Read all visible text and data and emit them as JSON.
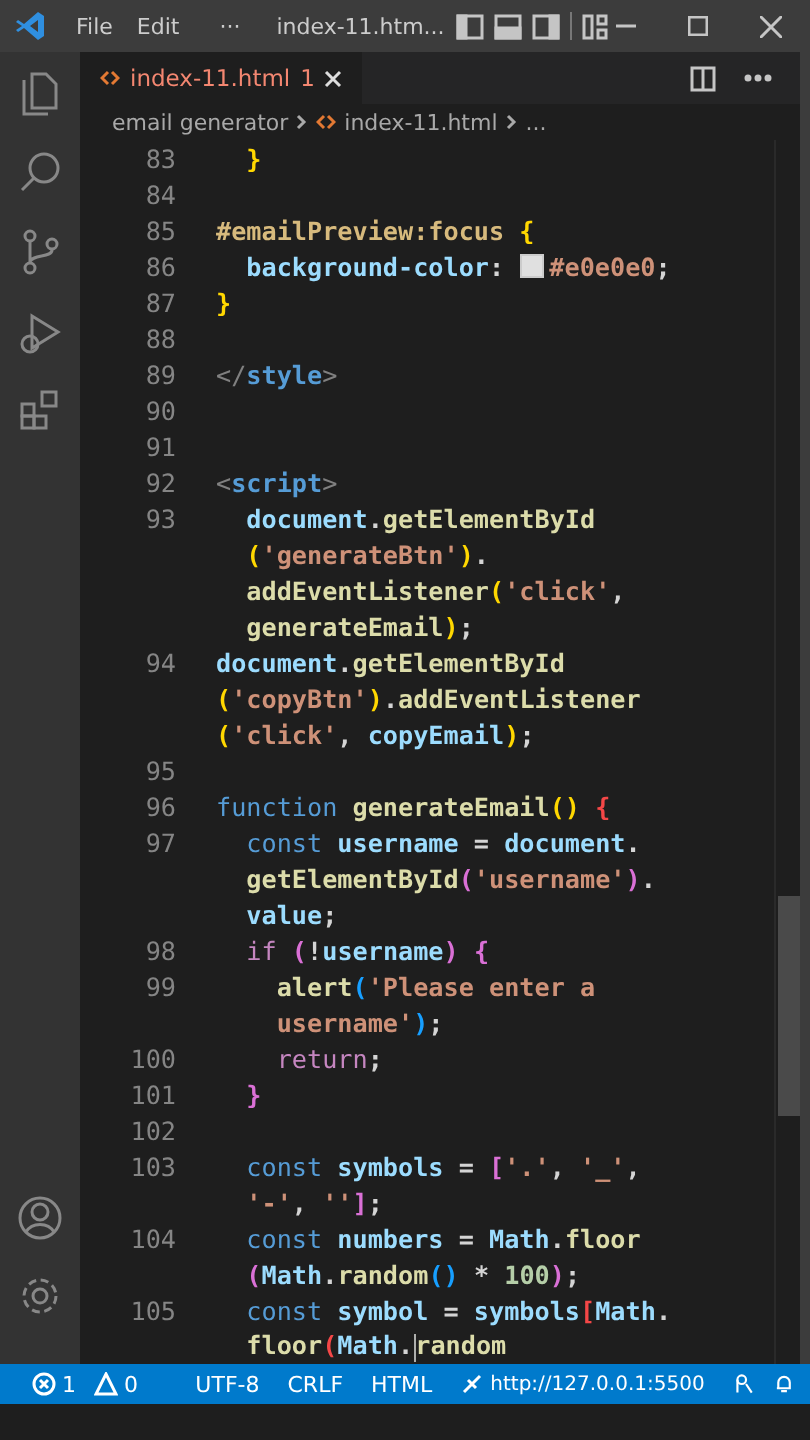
{
  "title_bar": {
    "menu": [
      "File",
      "Edit"
    ],
    "more": "···",
    "title": "index-11.htm..."
  },
  "tabs": [
    {
      "label": "index-11.html",
      "badge": "1",
      "has_error": true,
      "selected": true
    }
  ],
  "breadcrumbs": [
    "email generator",
    "index-11.html",
    "..."
  ],
  "editor": {
    "lines": [
      {
        "number": "83",
        "rows": [
          {
            "tokens": [
              {
                "kind": "br1",
                "text": "  }"
              }
            ]
          }
        ]
      },
      {
        "number": "84",
        "rows": [
          {
            "tokens": []
          }
        ]
      },
      {
        "number": "85",
        "rows": [
          {
            "tokens": [
              {
                "kind": "sel",
                "text": "#emailPreview:focus "
              },
              {
                "kind": "br1",
                "text": "{"
              }
            ]
          }
        ]
      },
      {
        "number": "86",
        "rows": [
          {
            "tokens": [
              {
                "kind": "prop",
                "text": "  background-color"
              },
              {
                "kind": "p",
                "text": ": "
              },
              {
                "kind": "swatch",
                "color": "#e0e0e0"
              },
              {
                "kind": "str",
                "text": "#e0e0e0"
              },
              {
                "kind": "p",
                "text": ";"
              }
            ]
          }
        ]
      },
      {
        "number": "87",
        "rows": [
          {
            "tokens": [
              {
                "kind": "br1",
                "text": "}"
              }
            ]
          }
        ]
      },
      {
        "number": "88",
        "rows": [
          {
            "tokens": []
          }
        ]
      },
      {
        "number": "89",
        "rows": [
          {
            "tokens": [
              {
                "kind": "tag",
                "text": "</"
              },
              {
                "kind": "tagname",
                "text": "style"
              },
              {
                "kind": "tag",
                "text": ">"
              }
            ]
          }
        ]
      },
      {
        "number": "90",
        "rows": [
          {
            "tokens": []
          }
        ]
      },
      {
        "number": "91",
        "rows": [
          {
            "tokens": []
          }
        ]
      },
      {
        "number": "92",
        "rows": [
          {
            "tokens": [
              {
                "kind": "tag",
                "text": "<"
              },
              {
                "kind": "tagname",
                "text": "script"
              },
              {
                "kind": "tag",
                "text": ">"
              }
            ]
          }
        ]
      },
      {
        "number": "93",
        "rows": [
          {
            "tokens": [
              {
                "kind": "var",
                "text": "  document"
              },
              {
                "kind": "p",
                "text": "."
              },
              {
                "kind": "fn",
                "text": "getElementById"
              }
            ]
          },
          {
            "tokens": [
              {
                "kind": "br1",
                "text": "  ("
              },
              {
                "kind": "str",
                "text": "'generateBtn'"
              },
              {
                "kind": "br1",
                "text": ")"
              },
              {
                "kind": "p",
                "text": "."
              }
            ]
          },
          {
            "tokens": [
              {
                "kind": "fn",
                "text": "  addEventListener"
              },
              {
                "kind": "br1",
                "text": "("
              },
              {
                "kind": "str",
                "text": "'click'"
              },
              {
                "kind": "p",
                "text": ","
              }
            ]
          },
          {
            "tokens": [
              {
                "kind": "fn",
                "text": "  generateEmail"
              },
              {
                "kind": "br1",
                "text": ")"
              },
              {
                "kind": "p",
                "text": ";"
              }
            ]
          }
        ]
      },
      {
        "number": "94",
        "rows": [
          {
            "tokens": [
              {
                "kind": "var",
                "text": "document"
              },
              {
                "kind": "p",
                "text": "."
              },
              {
                "kind": "fn",
                "text": "getElementById"
              }
            ]
          },
          {
            "tokens": [
              {
                "kind": "br1",
                "text": "("
              },
              {
                "kind": "str",
                "text": "'copyBtn'"
              },
              {
                "kind": "br1",
                "text": ")"
              },
              {
                "kind": "p",
                "text": "."
              },
              {
                "kind": "fn",
                "text": "addEventListener"
              }
            ]
          },
          {
            "tokens": [
              {
                "kind": "br1",
                "text": "("
              },
              {
                "kind": "str",
                "text": "'click'"
              },
              {
                "kind": "p",
                "text": ", "
              },
              {
                "kind": "var",
                "text": "copyEmail"
              },
              {
                "kind": "br1",
                "text": ")"
              },
              {
                "kind": "p",
                "text": ";"
              }
            ]
          }
        ]
      },
      {
        "number": "95",
        "rows": [
          {
            "tokens": []
          }
        ]
      },
      {
        "number": "96",
        "rows": [
          {
            "tokens": [
              {
                "kind": "kw",
                "text": "function "
              },
              {
                "kind": "fn",
                "text": "generateEmail"
              },
              {
                "kind": "br1",
                "text": "() "
              },
              {
                "kind": "err",
                "text": "{"
              }
            ]
          }
        ]
      },
      {
        "number": "97",
        "rows": [
          {
            "tokens": [
              {
                "kind": "kw",
                "text": "  const "
              },
              {
                "kind": "var",
                "text": "username"
              },
              {
                "kind": "p",
                "text": " = "
              },
              {
                "kind": "var",
                "text": "document"
              },
              {
                "kind": "p",
                "text": "."
              }
            ]
          },
          {
            "tokens": [
              {
                "kind": "fn",
                "text": "  getElementById"
              },
              {
                "kind": "br2",
                "text": "("
              },
              {
                "kind": "str",
                "text": "'username'"
              },
              {
                "kind": "br2",
                "text": ")"
              },
              {
                "kind": "p",
                "text": "."
              }
            ]
          },
          {
            "tokens": [
              {
                "kind": "var",
                "text": "  value"
              },
              {
                "kind": "p",
                "text": ";"
              }
            ]
          }
        ]
      },
      {
        "number": "98",
        "rows": [
          {
            "tokens": [
              {
                "kind": "ctrl",
                "text": "  if "
              },
              {
                "kind": "br2",
                "text": "("
              },
              {
                "kind": "p",
                "text": "!"
              },
              {
                "kind": "var",
                "text": "username"
              },
              {
                "kind": "br2",
                "text": ") {"
              }
            ]
          }
        ]
      },
      {
        "number": "99",
        "rows": [
          {
            "tokens": [
              {
                "kind": "fn",
                "text": "    alert"
              },
              {
                "kind": "br3",
                "text": "("
              },
              {
                "kind": "str",
                "text": "'Please enter a"
              }
            ]
          },
          {
            "tokens": [
              {
                "kind": "str",
                "text": "    username'"
              },
              {
                "kind": "br3",
                "text": ")"
              },
              {
                "kind": "p",
                "text": ";"
              }
            ]
          }
        ]
      },
      {
        "number": "100",
        "rows": [
          {
            "tokens": [
              {
                "kind": "ctrl",
                "text": "    return"
              },
              {
                "kind": "p",
                "text": ";"
              }
            ]
          }
        ]
      },
      {
        "number": "101",
        "rows": [
          {
            "tokens": [
              {
                "kind": "br2",
                "text": "  }"
              }
            ]
          }
        ]
      },
      {
        "number": "102",
        "rows": [
          {
            "tokens": []
          }
        ]
      },
      {
        "number": "103",
        "rows": [
          {
            "tokens": [
              {
                "kind": "kw",
                "text": "  const "
              },
              {
                "kind": "var",
                "text": "symbols"
              },
              {
                "kind": "p",
                "text": " = "
              },
              {
                "kind": "br2",
                "text": "["
              },
              {
                "kind": "str",
                "text": "'.'"
              },
              {
                "kind": "p",
                "text": ", "
              },
              {
                "kind": "str",
                "text": "'_'"
              },
              {
                "kind": "p",
                "text": ","
              }
            ]
          },
          {
            "tokens": [
              {
                "kind": "str",
                "text": "  '-'"
              },
              {
                "kind": "p",
                "text": ", "
              },
              {
                "kind": "str",
                "text": "''"
              },
              {
                "kind": "br2",
                "text": "]"
              },
              {
                "kind": "p",
                "text": ";"
              }
            ]
          }
        ]
      },
      {
        "number": "104",
        "rows": [
          {
            "tokens": [
              {
                "kind": "kw",
                "text": "  const "
              },
              {
                "kind": "var",
                "text": "numbers"
              },
              {
                "kind": "p",
                "text": " = "
              },
              {
                "kind": "var",
                "text": "Math"
              },
              {
                "kind": "p",
                "text": "."
              },
              {
                "kind": "fn",
                "text": "floor"
              }
            ]
          },
          {
            "tokens": [
              {
                "kind": "br2",
                "text": "  ("
              },
              {
                "kind": "var",
                "text": "Math"
              },
              {
                "kind": "p",
                "text": "."
              },
              {
                "kind": "fn",
                "text": "random"
              },
              {
                "kind": "br3",
                "text": "()"
              },
              {
                "kind": "p",
                "text": " * "
              },
              {
                "kind": "num",
                "text": "100"
              },
              {
                "kind": "br2",
                "text": ")"
              },
              {
                "kind": "p",
                "text": ";"
              }
            ]
          }
        ]
      },
      {
        "number": "105",
        "rows": [
          {
            "tokens": [
              {
                "kind": "kw",
                "text": "  const "
              },
              {
                "kind": "var",
                "text": "symbol"
              },
              {
                "kind": "p",
                "text": " = "
              },
              {
                "kind": "var",
                "text": "symbols"
              },
              {
                "kind": "err",
                "text": "["
              },
              {
                "kind": "var",
                "text": "Math"
              },
              {
                "kind": "p",
                "text": "."
              }
            ]
          },
          {
            "tokens": [
              {
                "kind": "fn",
                "text": "  floor"
              },
              {
                "kind": "err",
                "text": "("
              },
              {
                "kind": "var",
                "text": "Math"
              },
              {
                "kind": "p",
                "text": "."
              },
              {
                "kind": "caret"
              },
              {
                "kind": "fn",
                "text": "random"
              }
            ]
          }
        ]
      }
    ]
  },
  "status_bar": {
    "errors": "1",
    "warnings": "0",
    "encoding": "UTF-8",
    "eol": "CRLF",
    "language": "HTML",
    "server": "http://127.0.0.1:5500"
  }
}
